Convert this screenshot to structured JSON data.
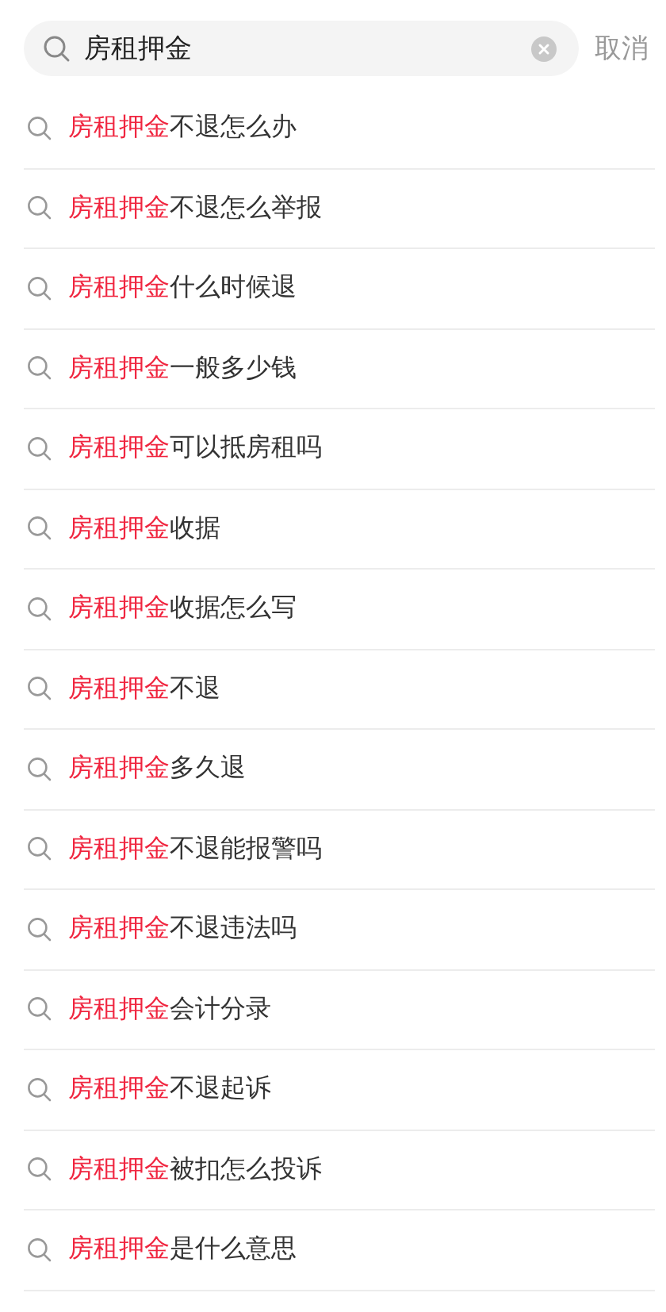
{
  "search": {
    "value": "房租押金",
    "cancel": "取消"
  },
  "suggestions": [
    {
      "match": "房租押金",
      "rest": "不退怎么办"
    },
    {
      "match": "房租押金",
      "rest": "不退怎么举报"
    },
    {
      "match": "房租押金",
      "rest": "什么时候退"
    },
    {
      "match": "房租押金",
      "rest": "一般多少钱"
    },
    {
      "match": "房租押金",
      "rest": "可以抵房租吗"
    },
    {
      "match": "房租押金",
      "rest": "收据"
    },
    {
      "match": "房租押金",
      "rest": "收据怎么写"
    },
    {
      "match": "房租押金",
      "rest": "不退"
    },
    {
      "match": "房租押金",
      "rest": "多久退"
    },
    {
      "match": "房租押金",
      "rest": "不退能报警吗"
    },
    {
      "match": "房租押金",
      "rest": "不退违法吗"
    },
    {
      "match": "房租押金",
      "rest": "会计分录"
    },
    {
      "match": "房租押金",
      "rest": "不退起诉"
    },
    {
      "match": "房租押金",
      "rest": "被扣怎么投诉"
    },
    {
      "match": "房租押金",
      "rest": "是什么意思"
    }
  ]
}
